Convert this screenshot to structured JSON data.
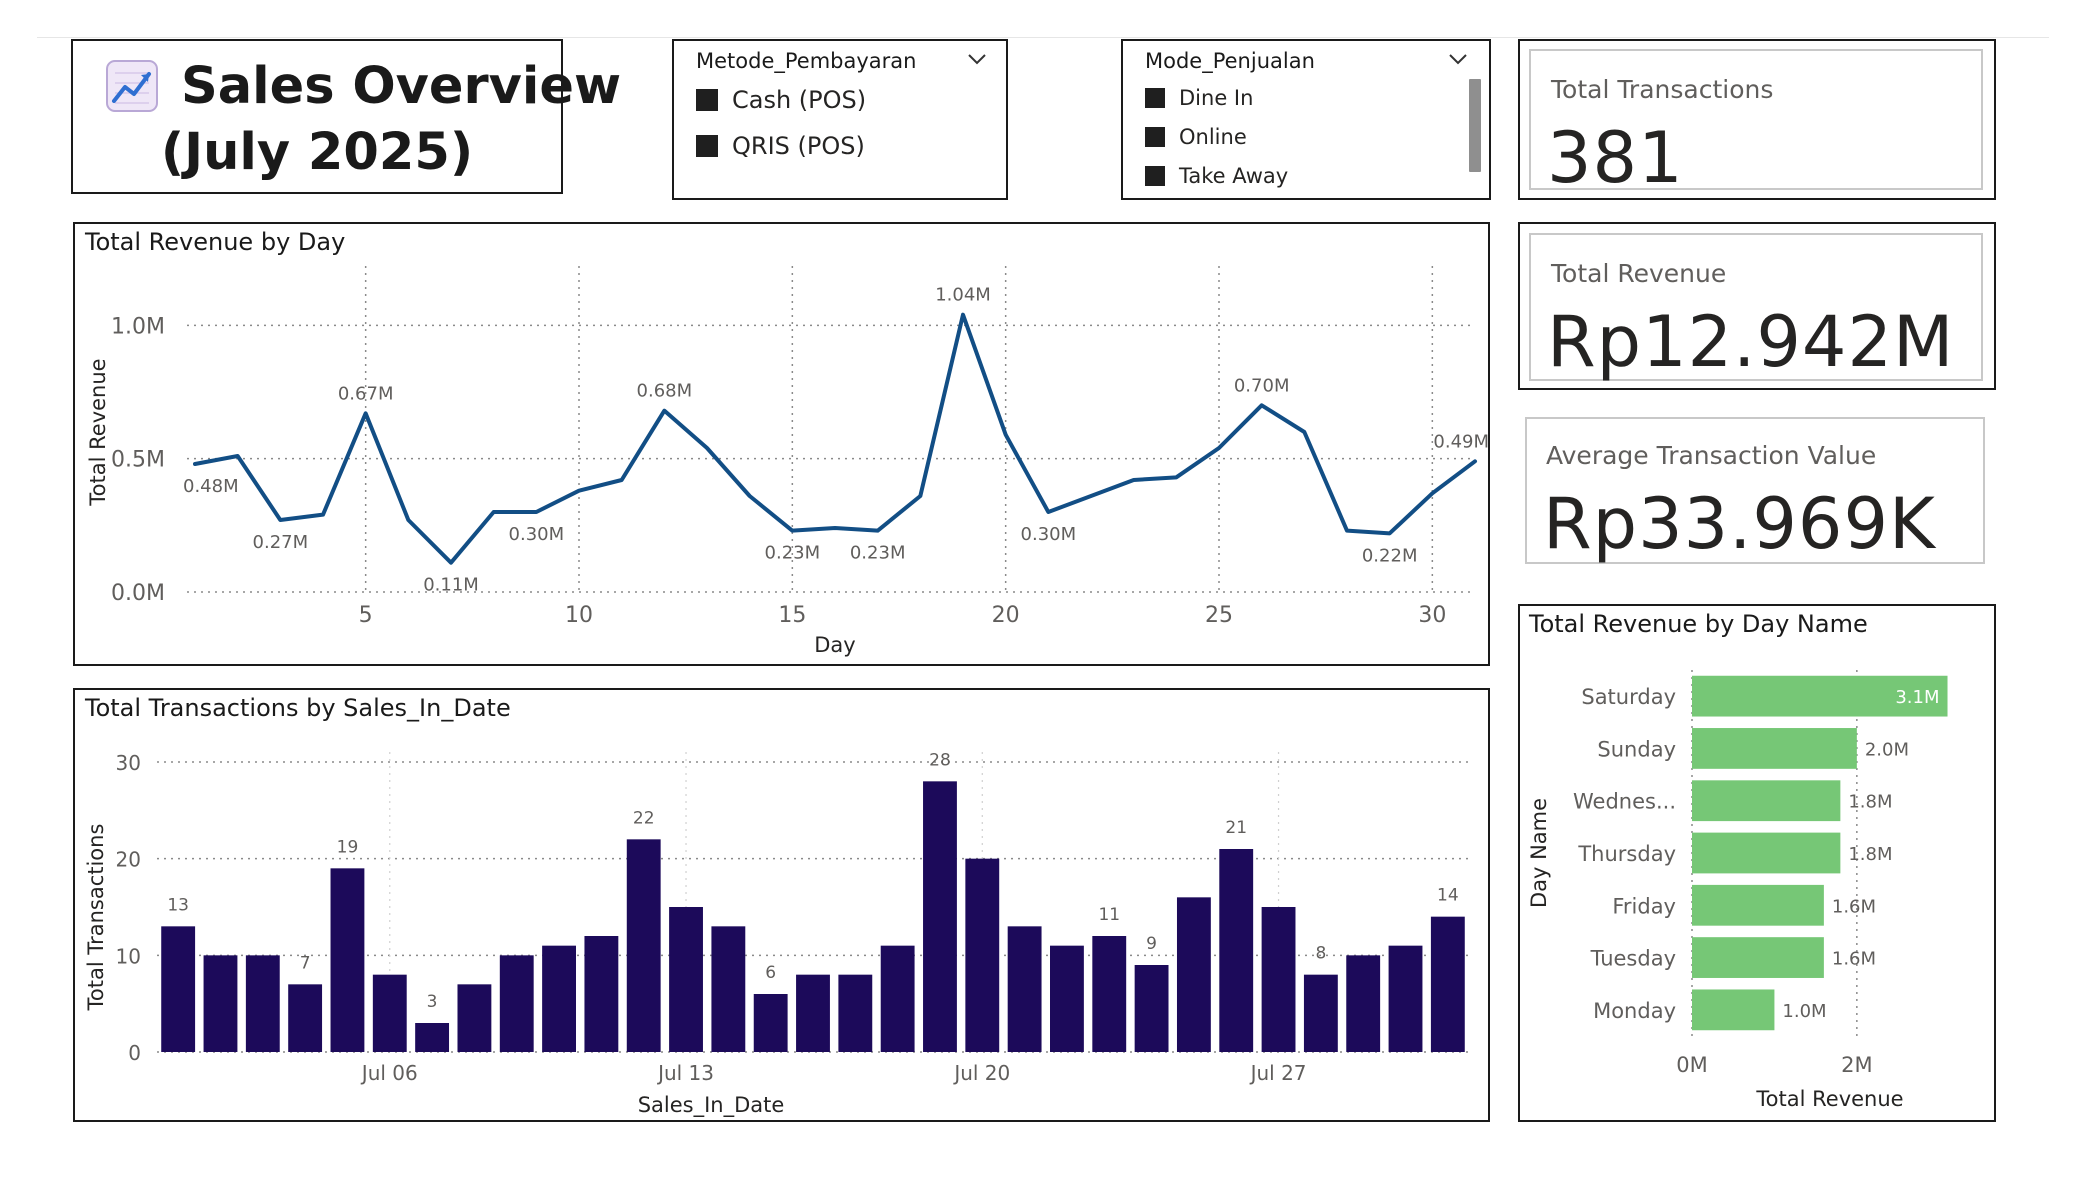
{
  "title": {
    "line1": "Sales Overview",
    "line2": "(July 2025)",
    "icon": "chart-increasing-icon"
  },
  "slicers": {
    "payment": {
      "title": "Metode_Pembayaran",
      "options": [
        "Cash (POS)",
        "QRIS (POS)"
      ]
    },
    "mode": {
      "title": "Mode_Penjualan",
      "options": [
        "Dine In",
        "Online",
        "Take Away"
      ]
    }
  },
  "kpis": {
    "total_transactions": {
      "label": "Total Transactions",
      "value": "381"
    },
    "total_revenue": {
      "label": "Total Revenue",
      "value": "Rp12.942M"
    },
    "avg_transaction": {
      "label": "Average Transaction Value",
      "value": "Rp33.969K"
    }
  },
  "colors": {
    "line": "#124e85",
    "bar": "#1c0a5a",
    "hbar": "#76c776",
    "grid": "#8a8a8a",
    "axis_text": "#605e5c"
  },
  "chart_data": [
    {
      "type": "line",
      "title": "Total Revenue by Day",
      "xlabel": "Day",
      "ylabel": "Total Revenue",
      "x": [
        1,
        2,
        3,
        4,
        5,
        6,
        7,
        8,
        9,
        10,
        11,
        12,
        13,
        14,
        15,
        16,
        17,
        18,
        19,
        20,
        21,
        22,
        23,
        24,
        25,
        26,
        27,
        28,
        29,
        30,
        31
      ],
      "values": [
        0.48,
        0.51,
        0.27,
        0.29,
        0.67,
        0.27,
        0.11,
        0.3,
        0.3,
        0.38,
        0.42,
        0.68,
        0.54,
        0.36,
        0.23,
        0.24,
        0.23,
        0.36,
        1.04,
        0.59,
        0.3,
        0.36,
        0.42,
        0.43,
        0.54,
        0.7,
        0.6,
        0.23,
        0.22,
        0.37,
        0.49
      ],
      "unit": "M",
      "xticks": [
        5,
        10,
        15,
        20,
        25,
        30
      ],
      "yticks": [
        0.0,
        0.5,
        1.0
      ],
      "ytick_labels": [
        "0.0M",
        "0.5M",
        "1.0M"
      ],
      "xlim": [
        1,
        31
      ],
      "ylim": [
        0,
        1.2
      ],
      "grid": true,
      "data_labels": [
        {
          "x": 1,
          "text": "0.48M"
        },
        {
          "x": 3,
          "text": "0.27M"
        },
        {
          "x": 5,
          "text": "0.67M"
        },
        {
          "x": 7,
          "text": "0.11M"
        },
        {
          "x": 9,
          "text": "0.30M"
        },
        {
          "x": 12,
          "text": "0.68M"
        },
        {
          "x": 15,
          "text": "0.23M"
        },
        {
          "x": 17,
          "text": "0.23M"
        },
        {
          "x": 19,
          "text": "1.04M"
        },
        {
          "x": 21,
          "text": "0.30M"
        },
        {
          "x": 26,
          "text": "0.70M"
        },
        {
          "x": 29,
          "text": "0.22M"
        },
        {
          "x": 31,
          "text": "0.49M"
        }
      ]
    },
    {
      "type": "bar",
      "title": "Total Transactions by Sales_In_Date",
      "xlabel": "Sales_In_Date",
      "ylabel": "Total Transactions",
      "categories": [
        "Jul 01",
        "Jul 02",
        "Jul 03",
        "Jul 04",
        "Jul 05",
        "Jul 06",
        "Jul 07",
        "Jul 08",
        "Jul 09",
        "Jul 10",
        "Jul 11",
        "Jul 12",
        "Jul 13",
        "Jul 14",
        "Jul 15",
        "Jul 16",
        "Jul 17",
        "Jul 18",
        "Jul 19",
        "Jul 20",
        "Jul 21",
        "Jul 22",
        "Jul 23",
        "Jul 24",
        "Jul 25",
        "Jul 26",
        "Jul 27",
        "Jul 28",
        "Jul 29",
        "Jul 30",
        "Jul 31"
      ],
      "values": [
        13,
        10,
        10,
        7,
        19,
        8,
        3,
        7,
        10,
        11,
        12,
        22,
        15,
        13,
        6,
        8,
        8,
        11,
        28,
        20,
        13,
        11,
        12,
        9,
        16,
        21,
        15,
        8,
        10,
        11,
        14
      ],
      "data_labels": [
        {
          "i": 0,
          "text": "13"
        },
        {
          "i": 3,
          "text": "7"
        },
        {
          "i": 4,
          "text": "19"
        },
        {
          "i": 6,
          "text": "3"
        },
        {
          "i": 11,
          "text": "22"
        },
        {
          "i": 14,
          "text": "6"
        },
        {
          "i": 18,
          "text": "28"
        },
        {
          "i": 22,
          "text": "11"
        },
        {
          "i": 23,
          "text": "9"
        },
        {
          "i": 25,
          "text": "21"
        },
        {
          "i": 27,
          "text": "8"
        },
        {
          "i": 30,
          "text": "14"
        }
      ],
      "xtick_labels": [
        {
          "i": 5,
          "text": "Jul 06"
        },
        {
          "i": 12,
          "text": "Jul 13"
        },
        {
          "i": 19,
          "text": "Jul 20"
        },
        {
          "i": 26,
          "text": "Jul 27"
        }
      ],
      "yticks": [
        0,
        10,
        20,
        30
      ],
      "ylim": [
        0,
        30
      ],
      "grid": true
    },
    {
      "type": "bar",
      "orientation": "horizontal",
      "title": "Total Revenue by Day Name",
      "xlabel": "Total Revenue",
      "ylabel": "Day Name",
      "categories": [
        "Saturday",
        "Sunday",
        "Wednes...",
        "Thursday",
        "Friday",
        "Tuesday",
        "Monday"
      ],
      "values": [
        3.1,
        2.0,
        1.8,
        1.8,
        1.6,
        1.6,
        1.0
      ],
      "value_labels": [
        "3.1M",
        "2.0M",
        "1.8M",
        "1.8M",
        "1.6M",
        "1.6M",
        "1.0M"
      ],
      "xticks": [
        0,
        2
      ],
      "xtick_labels": [
        "0M",
        "2M"
      ],
      "xlim": [
        0,
        3.3
      ],
      "grid": true
    }
  ]
}
